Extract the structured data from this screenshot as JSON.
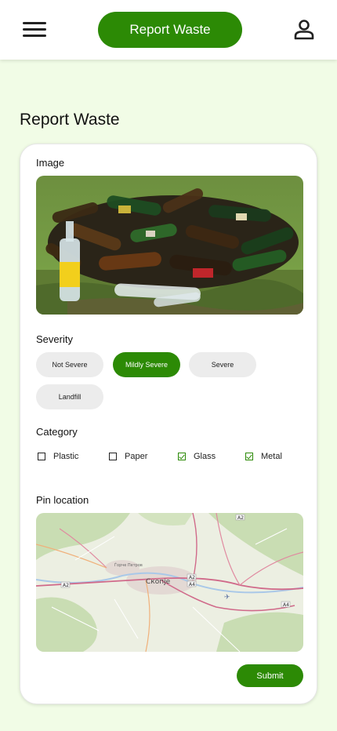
{
  "header": {
    "title_button": "Report Waste",
    "menu_icon": "hamburger-menu-icon",
    "profile_icon": "user-profile-icon"
  },
  "page": {
    "title": "Report Waste"
  },
  "form": {
    "image_label": "Image",
    "severity_label": "Severity",
    "severity_options": [
      "Not Severe",
      "Mildly Severe",
      "Severe",
      "Landfill"
    ],
    "severity_selected": "Mildly Severe",
    "category_label": "Category",
    "categories": [
      {
        "label": "Plastic",
        "checked": false
      },
      {
        "label": "Paper",
        "checked": false
      },
      {
        "label": "Glass",
        "checked": true
      },
      {
        "label": "Metal",
        "checked": true
      }
    ],
    "location_label": "Pin location",
    "map": {
      "city_label": "Скопје",
      "city_label_small": "Ѓорче Петров",
      "road_labels": [
        "A2",
        "A2",
        "A4",
        "A4",
        "A2"
      ]
    },
    "submit_label": "Submit"
  },
  "colors": {
    "accent": "#2c8a05",
    "background": "#f1fce6",
    "chip_inactive": "#ececec"
  }
}
